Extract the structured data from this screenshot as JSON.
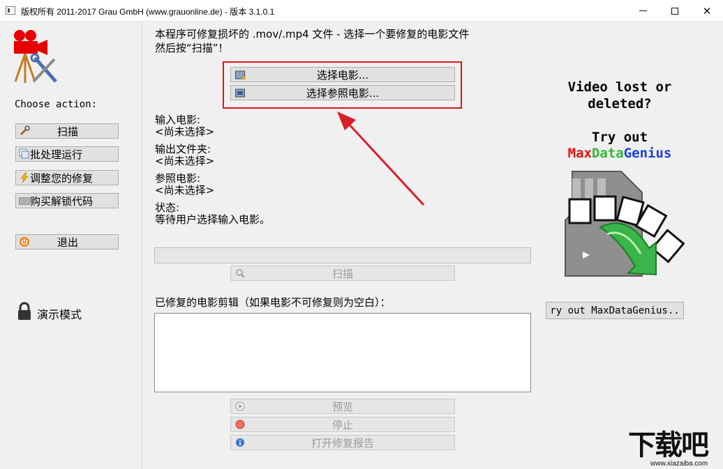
{
  "window": {
    "title": "版权所有 2011-2017 Grau GmbH (www.grauonline.de) - 版本 3.1.0.1",
    "controls": [
      "minimize",
      "maximize",
      "close"
    ]
  },
  "sidebar": {
    "logo_icon": "camera-repair-logo-icon",
    "choose_label": "Choose action:",
    "buttons": [
      {
        "label": "扫描",
        "icon": "wrench-icon"
      },
      {
        "label": "批处理运行",
        "icon": "batch-icon"
      },
      {
        "label": "调整您的修复",
        "icon": "lightning-icon"
      },
      {
        "label": "购买解锁代码",
        "icon": "keyboard-icon"
      },
      {
        "label": "退出",
        "icon": "power-icon"
      }
    ],
    "demo_mode": "演示模式"
  },
  "main": {
    "instruction_line1": "本程序可修复损坏的 .mov/.mp4 文件 - 选择一个要修复的电影文件",
    "instruction_line2": "然后按“扫描”！",
    "select_movie": "选择电影...",
    "select_reference": "选择参照电影...",
    "input_movie_label": "输入电影:",
    "input_movie_value": "<尚未选择>",
    "output_folder_label": "输出文件夹:",
    "output_folder_value": "<尚未选择>",
    "reference_label": "参照电影:",
    "reference_value": "<尚未选择>",
    "status_label": "状态:",
    "status_value": "等待用户选择输入电影。",
    "progress": 0,
    "scan_button": "扫描",
    "repaired_label": "已修复的电影剪辑（如果电影不可修复则为空白）：",
    "preview_button": "预览",
    "stop_button": "停止",
    "open_report_button": "打开修复报告"
  },
  "ad": {
    "line1": "Video lost or",
    "line2": "deleted?",
    "line3": "Try out",
    "brand_part1": "Max",
    "brand_part2": "Data",
    "brand_part3": "Genius",
    "brand_colors": {
      "part1": "#e81010",
      "part2": "#2fb82f",
      "part3": "#1a40e0"
    },
    "button": "ry out MaxDataGenius.."
  },
  "watermark": {
    "text": "下载吧",
    "url": "www.xiazaiba.com"
  },
  "colors": {
    "highlight": "#e0141b",
    "arrow": "#d81e28"
  }
}
